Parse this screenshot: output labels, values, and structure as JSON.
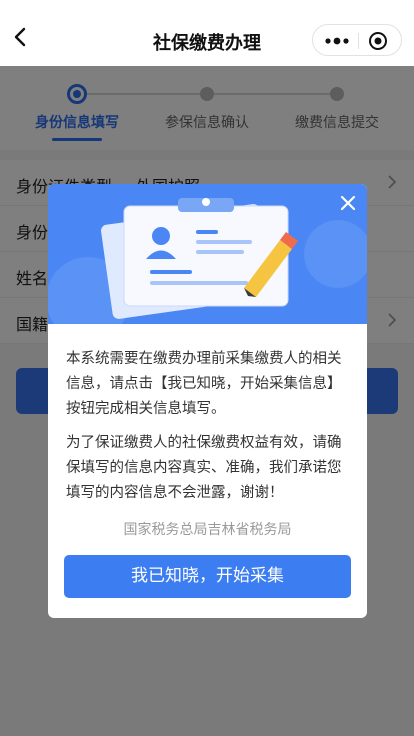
{
  "nav": {
    "title": "社保缴费办理",
    "icons": [
      "back-arrow-icon",
      "more-dots-icon",
      "target-circle-icon"
    ]
  },
  "steps": [
    {
      "label": "身份信息填写",
      "active": true
    },
    {
      "label": "参保信息确认",
      "active": false
    },
    {
      "label": "缴费信息提交",
      "active": false
    }
  ],
  "form": {
    "rows": [
      {
        "label": "身份证件类型",
        "value": "外国护照"
      },
      {
        "label": "身份证件号码",
        "value": ""
      },
      {
        "label": "姓名",
        "value": ""
      },
      {
        "label": "国籍",
        "value": ""
      }
    ]
  },
  "dialog": {
    "close_icon": "close-icon",
    "paragraph_1": "本系统需要在缴费办理前采集缴费人的相关信息，请点击【我已知晓，开始采集信息】按钮完成相关信息填写。",
    "paragraph_2": "为了保证缴费人的社保缴费权益有效，请确保填写的信息内容真实、准确，我们承诺您填写的内容信息不会泄露，谢谢！",
    "signer": "国家税务总局吉林省税务局",
    "confirm_label": "我已知晓，开始采集"
  },
  "colors": {
    "accent": "#2d6ff1",
    "banner": "#4a86f4",
    "button": "#3c7ef2",
    "mask": "rgba(0,0,0,0.5)"
  }
}
